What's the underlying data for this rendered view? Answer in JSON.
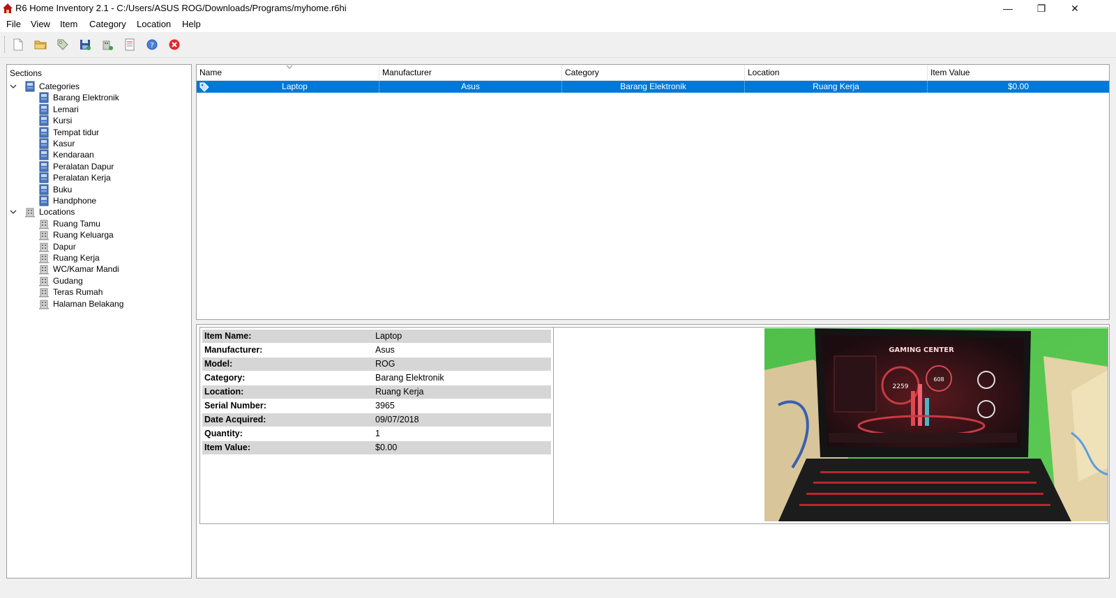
{
  "window": {
    "title": "R6 Home Inventory 2.1 - C:/Users/ASUS ROG/Downloads/Programs/myhome.r6hi",
    "minimize_glyph": "—",
    "maximize_glyph": "❐",
    "close_glyph": "✕"
  },
  "menu": [
    "File",
    "View",
    "Item",
    "Category",
    "Location",
    "Help"
  ],
  "toolbar": {
    "buttons": [
      "new-file-icon",
      "open-folder-icon",
      "tag-icon",
      "save-icon",
      "add-location-icon",
      "report-icon",
      "help-icon",
      "exit-icon"
    ]
  },
  "sections": {
    "header": "Sections",
    "categories_label": "Categories",
    "categories": [
      "Barang Elektronik",
      "Lemari",
      "Kursi",
      "Tempat tidur",
      "Kasur",
      "Kendaraan",
      "Peralatan Dapur",
      "Peralatan Kerja",
      "Buku",
      "Handphone"
    ],
    "locations_label": "Locations",
    "locations": [
      "Ruang Tamu",
      "Ruang Keluarga",
      "Dapur",
      "Ruang Kerja",
      "WC/Kamar Mandi",
      "Gudang",
      "Teras Rumah",
      "Halaman Belakang"
    ]
  },
  "list": {
    "columns": [
      "Name",
      "Manufacturer",
      "Category",
      "Location",
      "Item Value"
    ],
    "rows": [
      {
        "name": "Laptop",
        "manufacturer": "Asus",
        "category": "Barang Elektronik",
        "location": "Ruang Kerja",
        "value": "$0.00"
      }
    ]
  },
  "details": [
    {
      "label": "Item Name:",
      "value": "Laptop"
    },
    {
      "label": "Manufacturer:",
      "value": "Asus"
    },
    {
      "label": "Model:",
      "value": "ROG"
    },
    {
      "label": "Category:",
      "value": "Barang Elektronik"
    },
    {
      "label": "Location:",
      "value": "Ruang Kerja"
    },
    {
      "label": "Serial Number:",
      "value": "3965"
    },
    {
      "label": "Date Acquired:",
      "value": "09/07/2018"
    },
    {
      "label": "Quantity:",
      "value": "1"
    },
    {
      "label": "Item Value:",
      "value": "$0.00"
    }
  ],
  "photo": {
    "screen_title": "GAMING CENTER",
    "center_number": "2259",
    "gauge_number": "608"
  },
  "colors": {
    "selection": "#0078d7",
    "alt_row": "#d6d6d6",
    "border": "#a0a0a0"
  }
}
